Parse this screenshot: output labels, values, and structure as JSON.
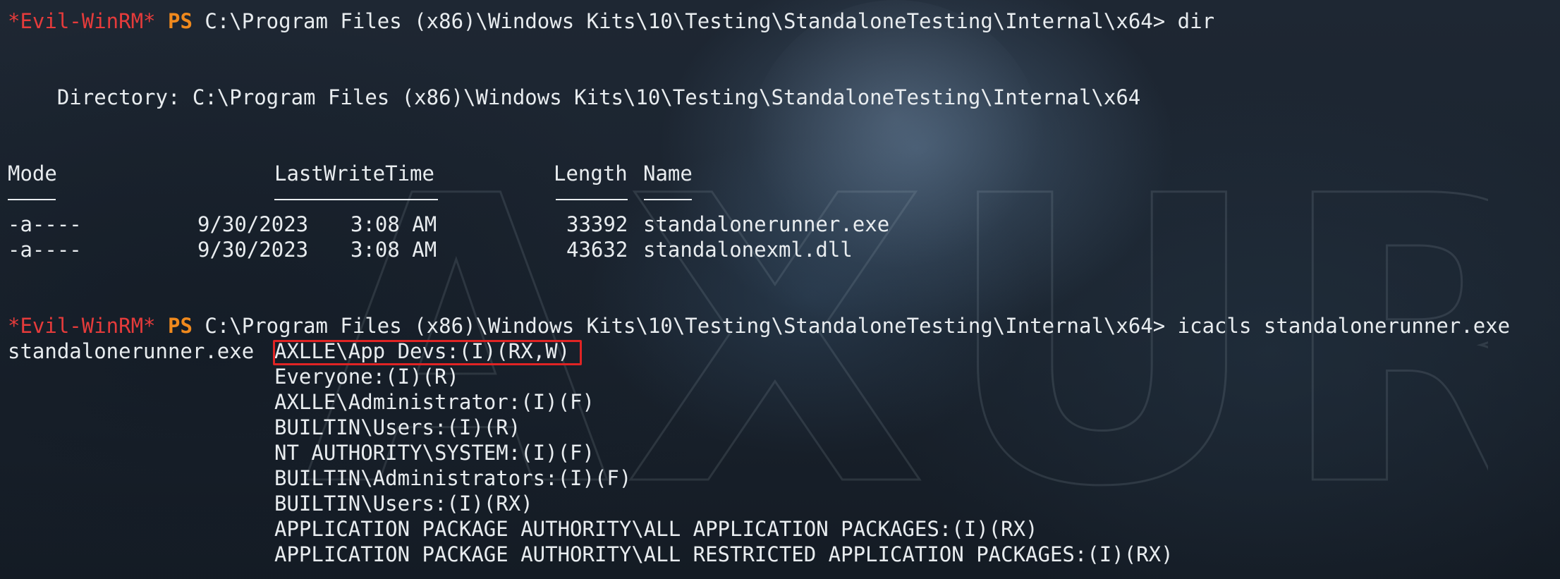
{
  "prompt": {
    "name": "*Evil-WinRM*",
    "ps": "PS",
    "path": "C:\\Program Files (x86)\\Windows Kits\\10\\Testing\\StandaloneTesting\\Internal\\x64>"
  },
  "commands": {
    "first": " dir",
    "second": " icacls standalonerunner.exe"
  },
  "directory_line": "    Directory: C:\\Program Files (x86)\\Windows Kits\\10\\Testing\\StandaloneTesting\\Internal\\x64",
  "listing": {
    "headers": {
      "mode": "Mode",
      "last_write_time": "LastWriteTime",
      "length": "Length",
      "name": "Name"
    },
    "rows": [
      {
        "mode": "-a----",
        "date": "9/30/2023",
        "time": "3:08 AM",
        "length": "33392",
        "name": "standalonerunner.exe"
      },
      {
        "mode": "-a----",
        "date": "9/30/2023",
        "time": "3:08 AM",
        "length": "43632",
        "name": "standalonexml.dll"
      }
    ]
  },
  "icacls": {
    "file": "standalonerunner.exe",
    "entries": [
      "AXLLE\\App Devs:(I)(RX,W)",
      "Everyone:(I)(R)",
      "AXLLE\\Administrator:(I)(F)",
      "BUILTIN\\Users:(I)(R)",
      "NT AUTHORITY\\SYSTEM:(I)(F)",
      "BUILTIN\\Administrators:(I)(F)",
      "BUILTIN\\Users:(I)(RX)",
      "APPLICATION PACKAGE AUTHORITY\\ALL APPLICATION PACKAGES:(I)(RX)",
      "APPLICATION PACKAGE AUTHORITY\\ALL RESTRICTED APPLICATION PACKAGES:(I)(RX)"
    ]
  },
  "watermark": "AXURA",
  "colors": {
    "prompt_name": "#e53b3b",
    "prompt_ps": "#f0891d",
    "text": "#e8ecef",
    "highlight_box": "#e02424"
  }
}
